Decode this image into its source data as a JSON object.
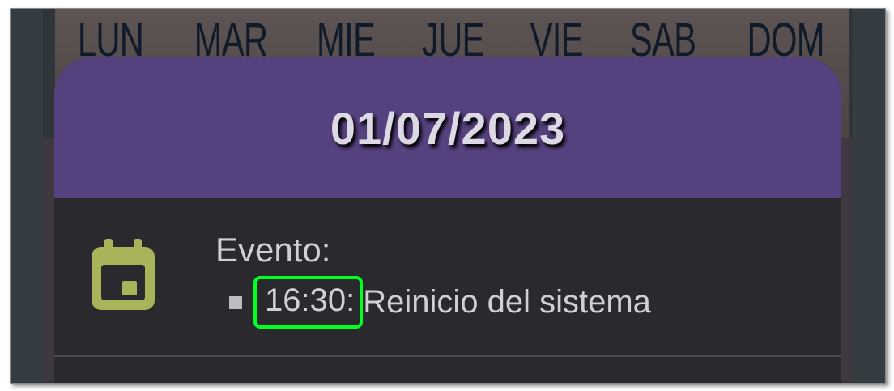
{
  "calendar": {
    "weekdays": [
      "LUN",
      "MAR",
      "MIE",
      "JUE",
      "VIE",
      "SAB",
      "DOM"
    ]
  },
  "dialog": {
    "title": "01/07/2023",
    "event_label": "Evento:",
    "events": [
      {
        "time": "16:30:",
        "description": "Reinicio del sistema"
      }
    ],
    "icon": "calendar-icon",
    "colors": {
      "header": "#55417d",
      "body": "#2a292e",
      "icon": "#a8b35a",
      "highlight": "#00ff22"
    }
  }
}
